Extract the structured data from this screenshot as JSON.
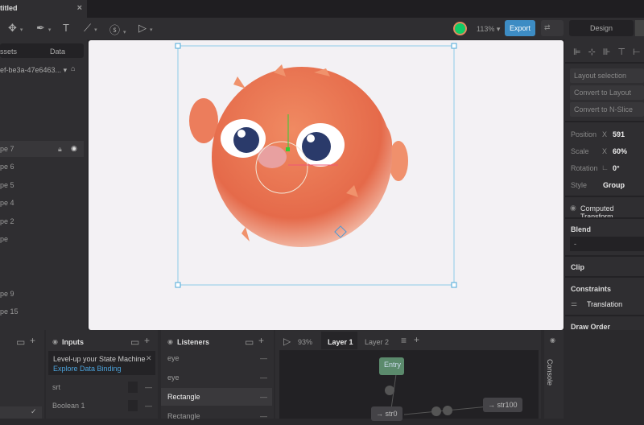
{
  "window": {
    "tab_title": "titled",
    "close": "×"
  },
  "toolbar": {
    "zoom": "113%",
    "export": "Export",
    "mode_design": "Design"
  },
  "left_panel": {
    "tabs": [
      "ssets",
      "Data"
    ],
    "artboard": "ef-be3a-47e6463...",
    "layers": [
      "pe 7",
      "pe 6",
      "pe 5",
      "pe 4",
      "pe 2",
      "pe",
      "pe 9",
      "pe 15"
    ]
  },
  "right_panel": {
    "layout_selection": "Layout selection",
    "convert_layout": "Convert to Layout",
    "convert_nslice": "Convert to N-Slice",
    "position_label": "Position",
    "position_axis": "X",
    "position_value": "591",
    "scale_label": "Scale",
    "scale_axis": "X",
    "scale_value": "60%",
    "rotation_label": "Rotation",
    "rotation_value": "0°",
    "style_label": "Style",
    "style_value": "Group",
    "computed_transform": "Computed Transform",
    "blend": "Blend",
    "blend_value": "-",
    "clip": "Clip",
    "constraints": "Constraints",
    "translation": "Translation",
    "draw_order": "Draw Order"
  },
  "inputs": {
    "title": "Inputs",
    "banner_text": "Level-up your State Machine",
    "banner_link": "Explore Data Binding",
    "items": [
      "srt",
      "Boolean 1"
    ]
  },
  "listeners": {
    "title": "Listeners",
    "items": [
      "eye",
      "eye",
      "Rectangle",
      "Rectangle"
    ]
  },
  "graph": {
    "zoom": "93%",
    "layers": [
      "Layer 1",
      "Layer 2"
    ],
    "nodes": {
      "entry": "Entry",
      "str0": "→ str0",
      "str100": "→ str100"
    },
    "console": "Console"
  },
  "colors": {
    "accent": "#3d8cc4",
    "entry": "#5b8a6c",
    "canvas": "#f3f1f4"
  }
}
